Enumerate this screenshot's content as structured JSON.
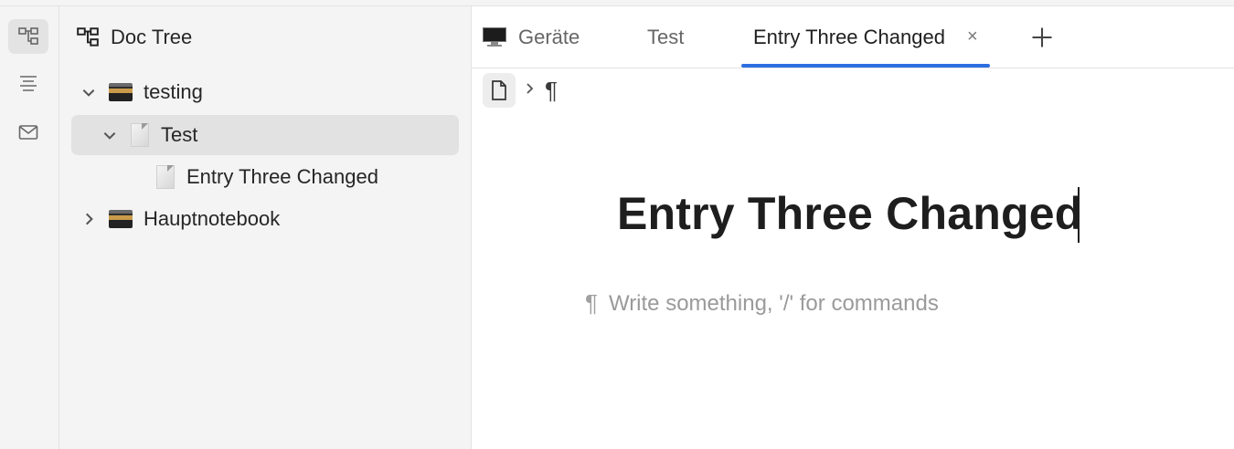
{
  "activity_bar": {
    "items": [
      {
        "name": "doc-tree",
        "icon": "tree-icon",
        "active": true
      },
      {
        "name": "outline",
        "icon": "outline-icon",
        "active": false
      },
      {
        "name": "inbox",
        "icon": "mail-icon",
        "active": false
      }
    ]
  },
  "sidebar": {
    "title": "Doc Tree",
    "items": [
      {
        "label": "testing",
        "type": "notebook",
        "expanded": true
      },
      {
        "label": "Test",
        "type": "page",
        "expanded": true,
        "selected": true
      },
      {
        "label": "Entry Three Changed",
        "type": "page"
      },
      {
        "label": "Hauptnotebook",
        "type": "notebook",
        "expanded": false
      }
    ]
  },
  "tabs": [
    {
      "label": "Geräte",
      "icon": "monitor-icon",
      "active": false
    },
    {
      "label": "Test",
      "active": false
    },
    {
      "label": "Entry Three Changed",
      "active": true,
      "close": "×"
    }
  ],
  "breadcrumb": {
    "items": [
      "document-icon",
      "¶"
    ]
  },
  "editor": {
    "title": "Entry Three Changed",
    "placeholder_marker": "¶",
    "placeholder": "Write something, '/' for commands"
  },
  "colors": {
    "accent": "#2d6ee0",
    "sidebar_bg": "#f4f4f4",
    "selected_row": "#e2e2e2"
  }
}
